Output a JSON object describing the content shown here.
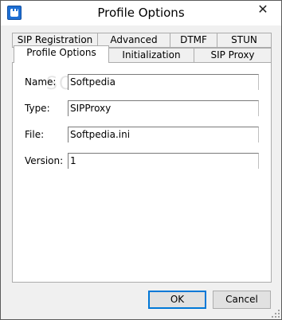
{
  "window": {
    "title": "Profile Options",
    "close_glyph": "✕"
  },
  "tabs": {
    "row1": [
      "SIP Registration",
      "Advanced",
      "DTMF",
      "STUN"
    ],
    "row2": [
      "Profile Options",
      "Initialization",
      "SIP Proxy"
    ],
    "active": "Profile Options"
  },
  "fields": {
    "name": {
      "label": "Name:",
      "value": "Softpedia"
    },
    "type": {
      "label": "Type:",
      "value": "SIPProxy"
    },
    "file": {
      "label": "File:",
      "value": "Softpedia.ini"
    },
    "version": {
      "label": "Version:",
      "value": "1"
    }
  },
  "watermark": "SOFTPEDIA",
  "buttons": {
    "ok": "OK",
    "cancel": "Cancel"
  },
  "colors": {
    "accent": "#0078d7",
    "icon": "#1e6fd4"
  }
}
